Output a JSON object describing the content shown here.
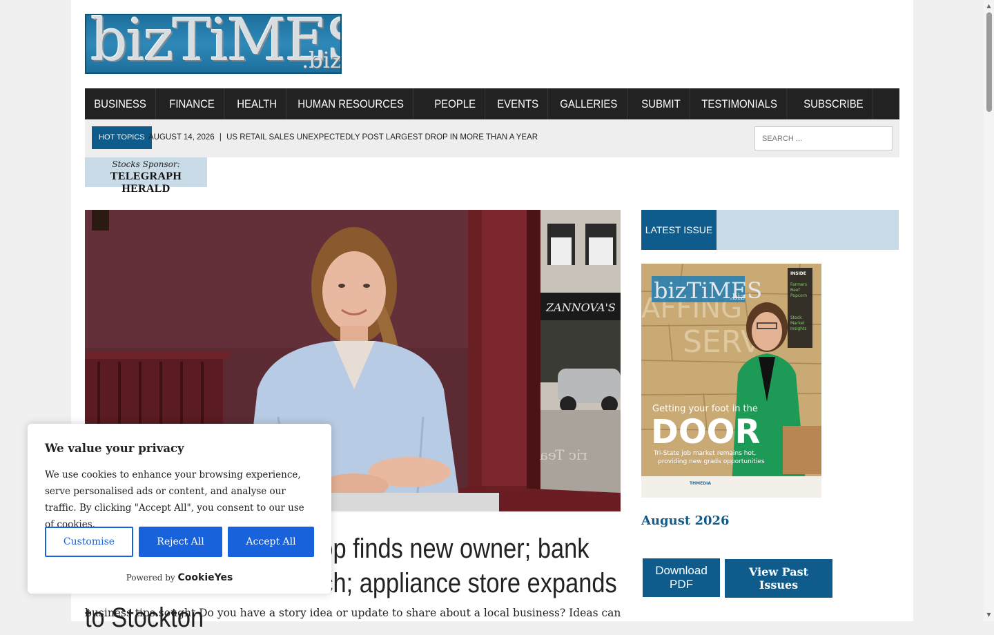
{
  "logo": {
    "main": "bizTiMES",
    "suffix": ".biz"
  },
  "nav": [
    "BUSINESS",
    "FINANCE",
    "HEALTH",
    "HUMAN RESOURCES",
    "PEOPLE",
    "EVENTS",
    "GALLERIES",
    "SUBMIT",
    "TESTIMONIALS",
    "SUBSCRIBE"
  ],
  "hot_topics": {
    "label": "HOT TOPICS",
    "date": "AUGUST 14, 2026",
    "separator": "|",
    "headline": "US RETAIL SALES UNEXPECTEDLY POST LARGEST DROP IN MORE THAN A YEAR"
  },
  "search": {
    "placeholder": "SEARCH ..."
  },
  "sponsor": {
    "line1": "Stocks Sponsor:",
    "line2": "TELEGRAPH HERALD"
  },
  "hero": {
    "storefront_sign": "ZANNOVA'S",
    "window_text": "ric Tea"
  },
  "article": {
    "headline": "Manchester brunch shop finds new owner; bank adds Manchester branch; appliance store expands to Stockton",
    "excerpt": "business tips sought Do you have a story idea or update to share about a local business? Ideas can be shared"
  },
  "sidebar": {
    "header": "LATEST ISSUE",
    "cover": {
      "brand": "bizTiMES",
      "brand_suffix": ".biz",
      "bg_words": [
        "AFFING",
        "SERV"
      ],
      "headline_small": "Getting your foot in the",
      "headline_big": "DOOR",
      "subline1": "Tri-State job market remains hot,",
      "subline2": "providing new grads opportunities",
      "inside_label": "INSIDE",
      "inside_text": [
        "Farmers",
        "Beef",
        "Popcorn",
        "Stock",
        "Market",
        "Insights"
      ],
      "footer_logo": "THMEDIA"
    },
    "issue_title": "August 2026",
    "download_label": "Download PDF",
    "past_label": "View Past Issues"
  },
  "cookie": {
    "title": "We value your privacy",
    "body": "We use cookies to enhance your browsing experience, serve personalised ads or content, and analyse our traffic. By clicking \"Accept All\", you consent to our use of cookies.",
    "customise": "Customise",
    "reject": "Reject All",
    "accept": "Accept All",
    "powered_by": "Powered by",
    "brand": "CookieYes"
  },
  "scrollbar": {
    "position": 0.02
  }
}
